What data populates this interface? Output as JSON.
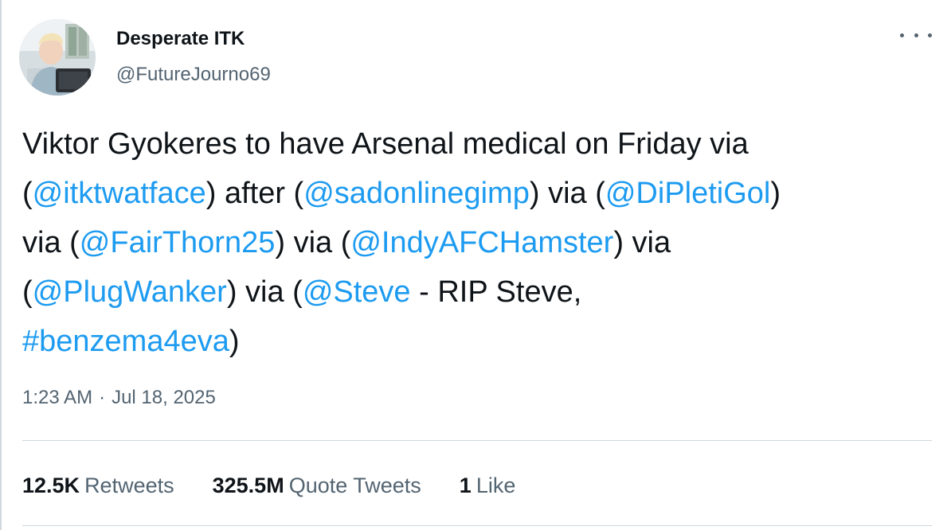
{
  "author": {
    "display_name": "Desperate ITK",
    "handle": "@FutureJourno69"
  },
  "tweet": {
    "lines": [
      [
        {
          "text": "Viktor Gyokeres to have Arsenal medical on Friday via",
          "type": "text"
        }
      ],
      [
        {
          "text": "(",
          "type": "text"
        },
        {
          "text": "@itktwatface",
          "type": "mention"
        },
        {
          "text": ") after (",
          "type": "text"
        },
        {
          "text": "@sadonlinegimp",
          "type": "mention"
        },
        {
          "text": ") via (",
          "type": "text"
        },
        {
          "text": "@DiPletiGol",
          "type": "mention"
        },
        {
          "text": ")",
          "type": "text"
        }
      ],
      [
        {
          "text": "via (",
          "type": "text"
        },
        {
          "text": "@FairThorn25",
          "type": "mention"
        },
        {
          "text": ") via (",
          "type": "text"
        },
        {
          "text": "@IndyAFCHamster",
          "type": "mention"
        },
        {
          "text": ") via",
          "type": "text"
        }
      ],
      [
        {
          "text": "(",
          "type": "text"
        },
        {
          "text": "@PlugWanker",
          "type": "mention"
        },
        {
          "text": ") via (",
          "type": "text"
        },
        {
          "text": "@Steve",
          "type": "mention"
        },
        {
          "text": " - RIP Steve,",
          "type": "text"
        }
      ],
      [
        {
          "text": "#benzema4eva",
          "type": "hashtag"
        },
        {
          "text": ")",
          "type": "text"
        }
      ]
    ]
  },
  "meta": {
    "time": "1:23 AM",
    "separator": "·",
    "date": "Jul 18, 2025"
  },
  "stats": [
    {
      "number": "12.5K",
      "label": "Retweets"
    },
    {
      "number": "325.5M",
      "label": "Quote Tweets"
    },
    {
      "number": "1",
      "label": "Like"
    }
  ],
  "icons": {
    "more": "more-horizontal-icon"
  },
  "colors": {
    "link": "#1d9bf0",
    "text": "#0f1419",
    "secondary": "#536471",
    "divider": "#cfd9de"
  }
}
